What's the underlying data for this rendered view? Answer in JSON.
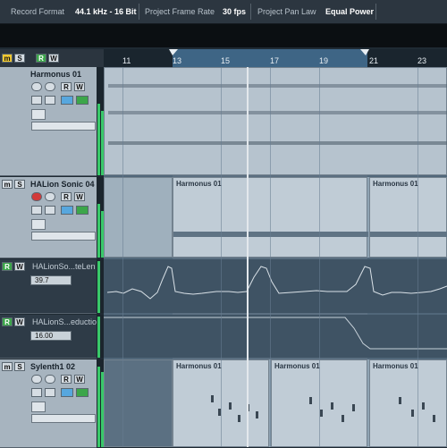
{
  "status": {
    "record_format_label": "Record Format",
    "record_format_value": "44.1 kHz - 16 Bit",
    "frame_rate_label": "Project Frame Rate",
    "frame_rate_value": "30 fps",
    "pan_law_label": "Project Pan Law",
    "pan_law_value": "Equal Power"
  },
  "toolbar_buttons": {
    "m": "m",
    "s": "S",
    "r": "R",
    "w": "W"
  },
  "ruler": {
    "bars": [
      "11",
      "13",
      "15",
      "17",
      "19",
      "21",
      "23"
    ]
  },
  "tracks": [
    {
      "name": "Harmonus 01"
    },
    {
      "name": "HALion Sonic 04",
      "parts": [
        "Harmonus 01",
        "Harmonus 01"
      ]
    },
    {
      "name": "HALionSo...teLen",
      "value": "39.7"
    },
    {
      "name": "HALionS...eduction",
      "value": "16.00"
    },
    {
      "name": "Sylenth1 02",
      "parts": [
        "Harmonus 01",
        "Harmonus 01",
        "Harmonus 01"
      ]
    }
  ],
  "colors": {
    "accent": "#3e6585",
    "meter": "#39c96a",
    "automation": "#ffffff"
  }
}
